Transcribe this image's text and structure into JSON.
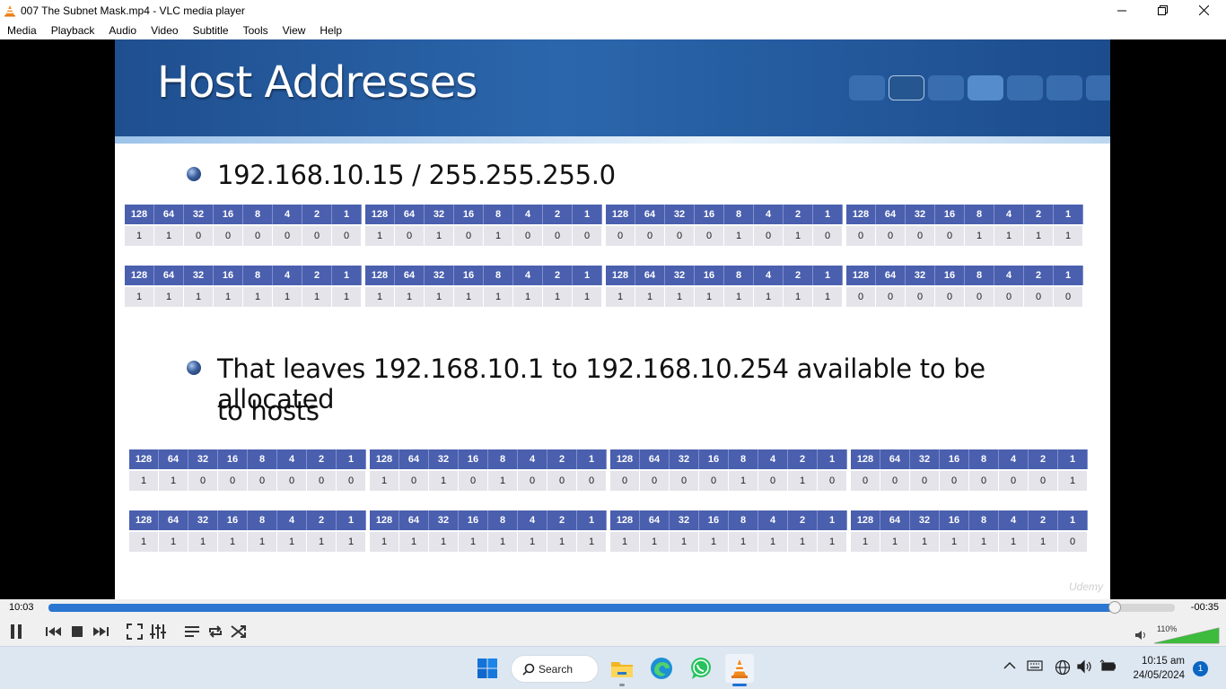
{
  "window": {
    "title": "007 The Subnet Mask.mp4 - VLC media player",
    "controls": [
      "minimize",
      "restore",
      "close"
    ]
  },
  "menu": [
    "Media",
    "Playback",
    "Audio",
    "Video",
    "Subtitle",
    "Tools",
    "View",
    "Help"
  ],
  "slide": {
    "title": "Host Addresses",
    "bullet1": "192.168.10.15 / 255.255.255.0",
    "bullet2_line1": "That leaves 192.168.10.1 to 192.168.10.254 available to be allocated",
    "bullet2_line2": "to hosts",
    "bit_headers": [
      "128",
      "64",
      "32",
      "16",
      "8",
      "4",
      "2",
      "1"
    ],
    "tables": [
      [
        [
          "1",
          "1",
          "0",
          "0",
          "0",
          "0",
          "0",
          "0"
        ],
        [
          "1",
          "0",
          "1",
          "0",
          "1",
          "0",
          "0",
          "0"
        ],
        [
          "0",
          "0",
          "0",
          "0",
          "1",
          "0",
          "1",
          "0"
        ],
        [
          "0",
          "0",
          "0",
          "0",
          "1",
          "1",
          "1",
          "1"
        ]
      ],
      [
        [
          "1",
          "1",
          "1",
          "1",
          "1",
          "1",
          "1",
          "1"
        ],
        [
          "1",
          "1",
          "1",
          "1",
          "1",
          "1",
          "1",
          "1"
        ],
        [
          "1",
          "1",
          "1",
          "1",
          "1",
          "1",
          "1",
          "1"
        ],
        [
          "0",
          "0",
          "0",
          "0",
          "0",
          "0",
          "0",
          "0"
        ]
      ],
      [
        [
          "1",
          "1",
          "0",
          "0",
          "0",
          "0",
          "0",
          "0"
        ],
        [
          "1",
          "0",
          "1",
          "0",
          "1",
          "0",
          "0",
          "0"
        ],
        [
          "0",
          "0",
          "0",
          "0",
          "1",
          "0",
          "1",
          "0"
        ],
        [
          "0",
          "0",
          "0",
          "0",
          "0",
          "0",
          "0",
          "1"
        ]
      ],
      [
        [
          "1",
          "1",
          "1",
          "1",
          "1",
          "1",
          "1",
          "1"
        ],
        [
          "1",
          "1",
          "1",
          "1",
          "1",
          "1",
          "1",
          "1"
        ],
        [
          "1",
          "1",
          "1",
          "1",
          "1",
          "1",
          "1",
          "1"
        ],
        [
          "1",
          "1",
          "1",
          "1",
          "1",
          "1",
          "1",
          "0"
        ]
      ]
    ],
    "watermark": "Udemy"
  },
  "player": {
    "time_elapsed": "10:03",
    "time_remaining": "-00:35",
    "progress_fraction": 0.947,
    "volume_label": "110%",
    "volume_fraction": 1.0,
    "accent": "#2a76d1"
  },
  "taskbar": {
    "search_label": "Search",
    "time": "10:15 am",
    "date": "24/05/2024",
    "notification_count": "1"
  }
}
